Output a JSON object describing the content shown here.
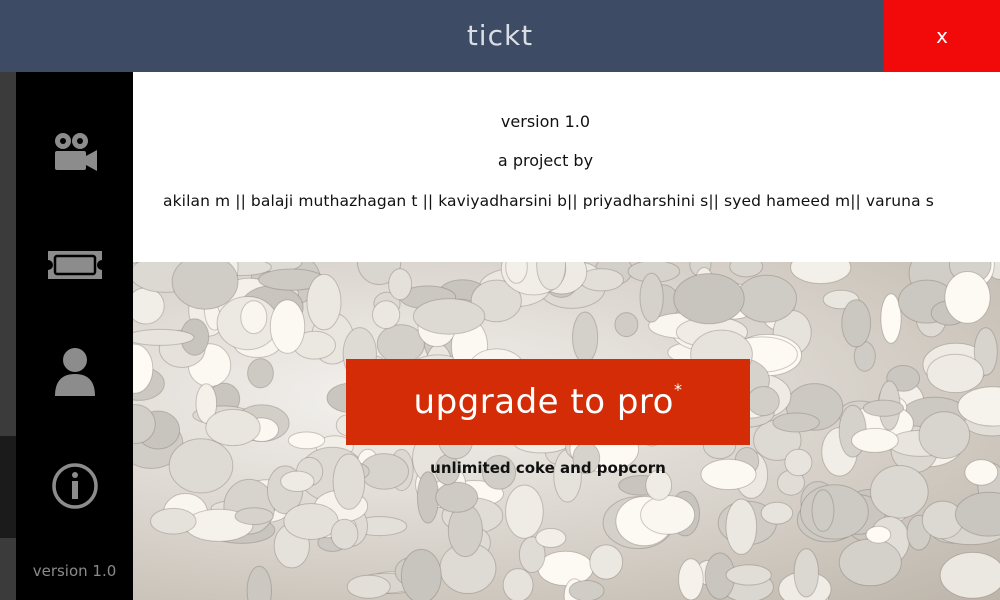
{
  "window": {
    "title": "tickt",
    "close_label": "x",
    "colors": {
      "titlebar": "#3d4b64",
      "close": "#f20a0a",
      "accent": "#d42c06"
    }
  },
  "sidebar": {
    "items": [
      {
        "icon": "movie-camera-icon"
      },
      {
        "icon": "ticket-icon"
      },
      {
        "icon": "user-icon"
      },
      {
        "icon": "info-icon"
      }
    ],
    "version": "version 1.0"
  },
  "about": {
    "version": "version 1.0",
    "project_by": "a project by",
    "authors": "akilan m || balaji muthazhagan t || kaviyadharsini b|| priyadharshini s|| syed hameed m|| varuna s"
  },
  "promo": {
    "button_label": "upgrade to pro",
    "button_mark": "*",
    "subtitle": "unlimited coke and popcorn"
  }
}
